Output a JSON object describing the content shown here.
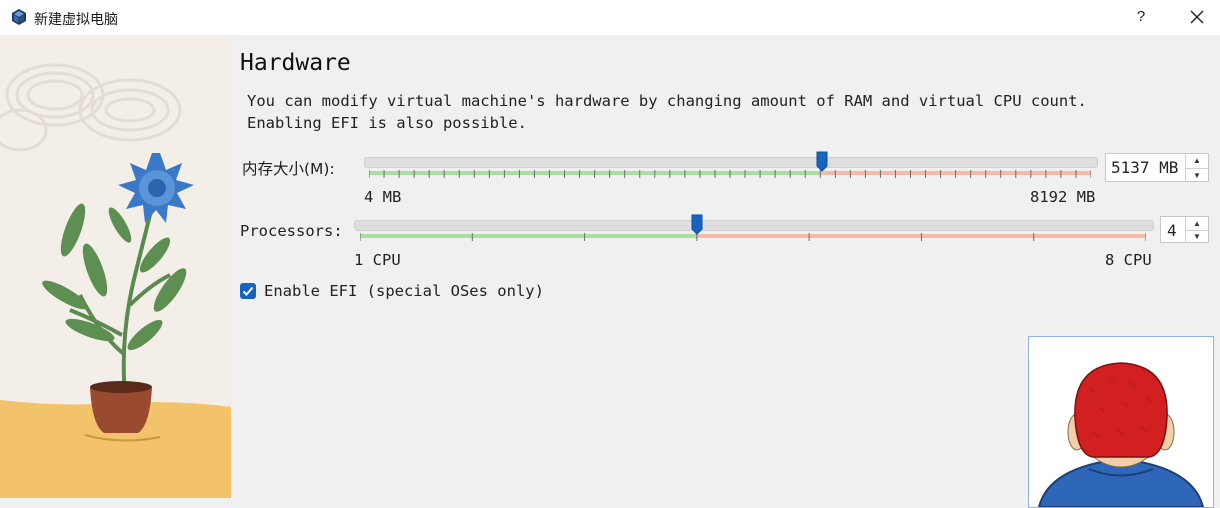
{
  "window": {
    "title": "新建虚拟电脑",
    "help_label": "?"
  },
  "page": {
    "heading": "Hardware",
    "description_line1": "You can modify virtual machine's hardware by changing amount of RAM and virtual CPU count.",
    "description_line2": "Enabling EFI is also possible."
  },
  "memory": {
    "label": "内存大小(M):",
    "min_label": "4 MB",
    "max_label": "8192 MB",
    "value": 5137,
    "min": 4,
    "max": 8192,
    "recommended_max_fraction": 0.625,
    "spin_text": "5137 MB"
  },
  "processors": {
    "label": "Processors:",
    "min_label": "1 CPU",
    "max_label": "8 CPU",
    "value": 4,
    "min": 1,
    "max": 8,
    "recommended_max": 4,
    "spin_text": "4"
  },
  "efi": {
    "label": "Enable EFI (special OSes only)",
    "checked": true
  },
  "colors": {
    "accent": "#1565c0",
    "safe": "#a8e0a0",
    "warn": "#f6b9a8"
  }
}
